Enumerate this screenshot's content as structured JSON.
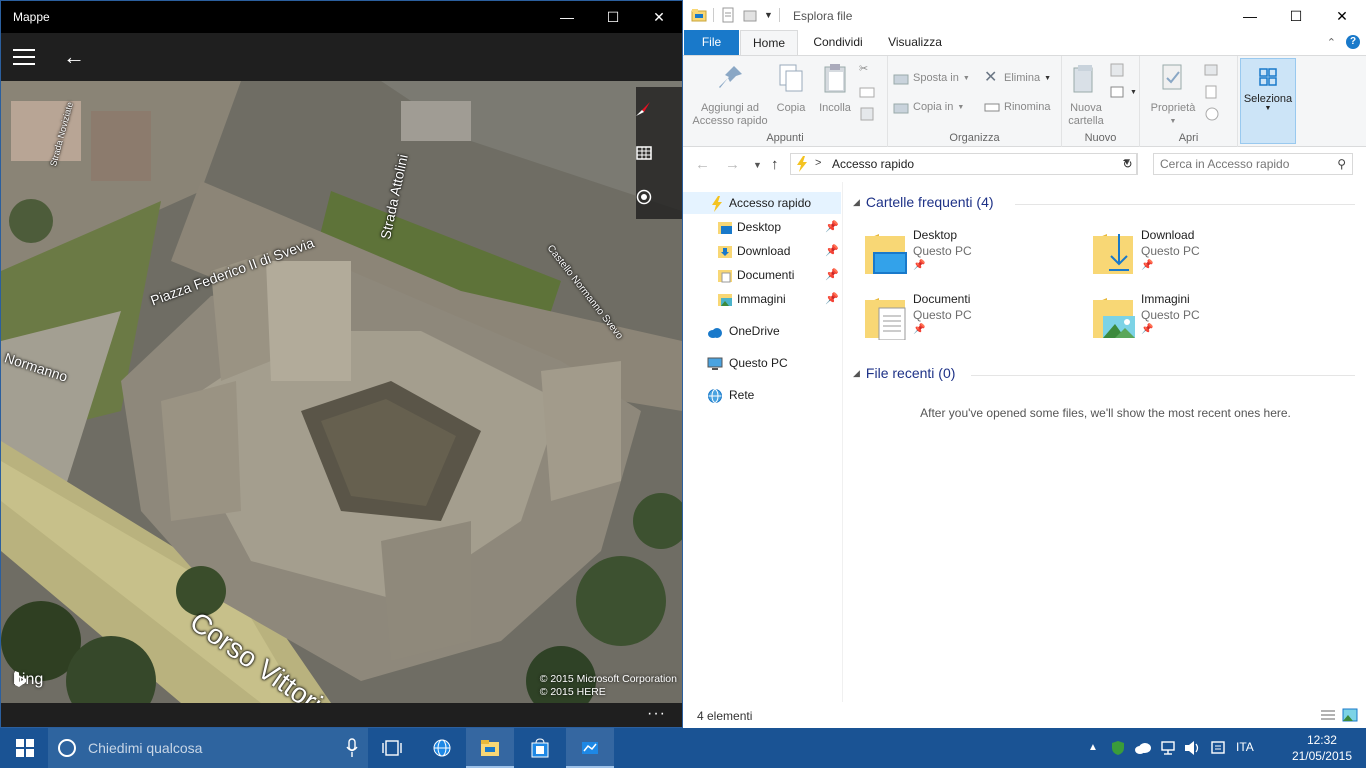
{
  "maps_window": {
    "title": "Mappe",
    "street_labels": [
      "Strada Attolini",
      "Piazza Federico II di Svevia",
      "Normanno",
      "Castello Normanno Svevo",
      "Corso Vittorio",
      "Strada Noviziate"
    ],
    "logo": "bing",
    "copyright_lines": [
      "© 2015 Microsoft Corporation",
      "© 2015 HERE"
    ],
    "more_label": "···"
  },
  "explorer": {
    "title": "Esplora file",
    "tabs": [
      "File",
      "Home",
      "Condividi",
      "Visualizza"
    ],
    "ribbon": {
      "pin_label": "Aggiungi ad Accesso rapido",
      "copy_label": "Copia",
      "paste_label": "Incolla",
      "group_clipboard": "Appunti",
      "move_to": "Sposta in",
      "copy_to": "Copia in",
      "delete": "Elimina",
      "rename": "Rinomina",
      "group_organize": "Organizza",
      "new_folder": "Nuova cartella",
      "group_new": "Nuovo",
      "properties": "Proprietà",
      "group_open": "Apri",
      "select": "Seleziona"
    },
    "address": {
      "path": "Accesso rapido",
      "search_placeholder": "Cerca in Accesso rapido"
    },
    "nav": {
      "quick_access": "Accesso rapido",
      "pinned": [
        "Desktop",
        "Download",
        "Documenti",
        "Immagini"
      ],
      "onedrive": "OneDrive",
      "this_pc": "Questo PC",
      "network": "Rete"
    },
    "frequent_header": "Cartelle frequenti (4)",
    "frequent_folders": [
      {
        "name": "Desktop",
        "location": "Questo PC"
      },
      {
        "name": "Download",
        "location": "Questo PC"
      },
      {
        "name": "Documenti",
        "location": "Questo PC"
      },
      {
        "name": "Immagini",
        "location": "Questo PC"
      }
    ],
    "recent_header": "File recenti (0)",
    "recent_empty": "After you've opened some files, we'll show the most recent ones here.",
    "status_count": "4 elementi"
  },
  "taskbar": {
    "search_placeholder": "Chiedimi qualcosa",
    "language": "ITA",
    "time": "12:32",
    "date": "21/05/2015"
  },
  "colors": {
    "taskbar": "#1a5394",
    "accent": "#1979ca",
    "folder_yellow": "#f8d775"
  }
}
